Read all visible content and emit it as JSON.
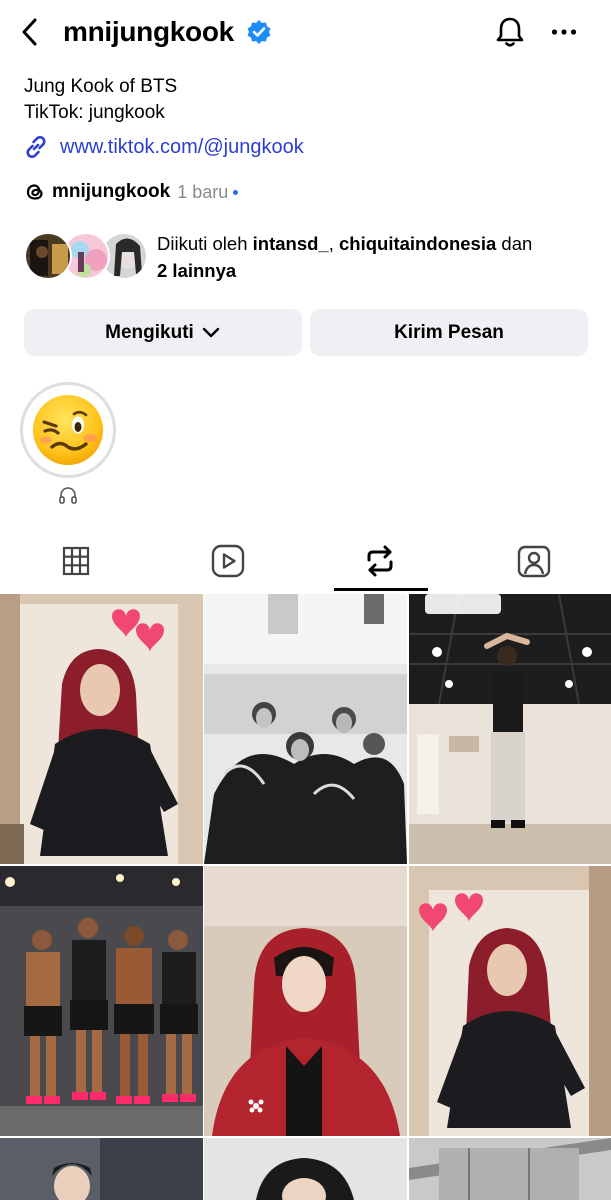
{
  "header": {
    "username": "mnijungkook",
    "icons": [
      "back-arrow-icon",
      "verified-badge-icon",
      "bell-icon",
      "more-icon"
    ]
  },
  "bio": {
    "line1": "Jung Kook of BTS",
    "line2": "TikTok: jungkook",
    "link": "www.tiktok.com/@jungkook"
  },
  "threads": {
    "name": "mnijungkook",
    "time": "1 baru"
  },
  "followed_by": {
    "prefix": "Diikuti oleh ",
    "user1": "intansd_",
    "separator": ", ",
    "user2": "chiquitaindonesia",
    "conjunction": " dan",
    "others": "2 lainnya"
  },
  "actions": {
    "follow_label": "Mengikuti",
    "message_label": "Kirim Pesan"
  },
  "highlight": {
    "emoji": "🥴"
  },
  "tabs": [
    {
      "name": "posts",
      "icon": "grid-icon"
    },
    {
      "name": "reels",
      "icon": "reels-icon"
    },
    {
      "name": "reposts",
      "icon": "repost-icon",
      "active": true
    },
    {
      "name": "tagged",
      "icon": "tagged-icon"
    }
  ],
  "grid": {
    "thumbnails": [
      {
        "alt": "red-haired dancer with hearts",
        "caption": ""
      },
      {
        "alt": "group photo black and white",
        "caption": ""
      },
      {
        "alt": "dance practice room",
        "caption": ""
      },
      {
        "alt": "group in gym clothes",
        "caption": ""
      },
      {
        "alt": "person in red hoodie",
        "caption": ""
      },
      {
        "alt": "red-haired dancer with hearts",
        "caption": ""
      }
    ]
  },
  "colors": {
    "link": "#2a3fd1",
    "verified": "#1d8cf8",
    "button_bg": "#eff0f3",
    "secondary_text": "#8a8a8a"
  }
}
